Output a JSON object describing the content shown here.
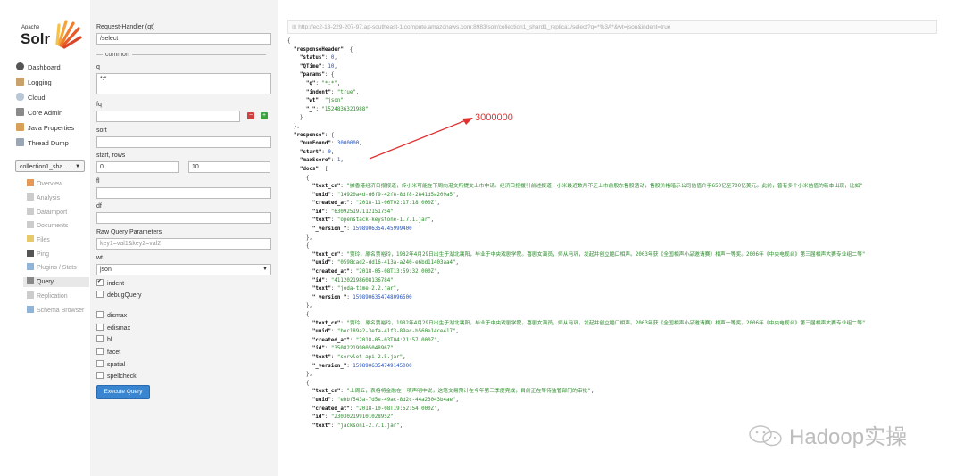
{
  "logo": {
    "apache": "Apache",
    "solr": "Solr"
  },
  "nav": {
    "items": [
      {
        "label": "Dashboard",
        "icon": "dashboard-icon"
      },
      {
        "label": "Logging",
        "icon": "logging-icon"
      },
      {
        "label": "Cloud",
        "icon": "cloud-icon"
      },
      {
        "label": "Core Admin",
        "icon": "core-admin-icon"
      },
      {
        "label": "Java Properties",
        "icon": "java-icon"
      },
      {
        "label": "Thread Dump",
        "icon": "thread-dump-icon"
      }
    ],
    "core_selector": "collection1_sha...",
    "core_items": [
      {
        "label": "Overview"
      },
      {
        "label": "Analysis"
      },
      {
        "label": "Dataimport"
      },
      {
        "label": "Documents"
      },
      {
        "label": "Files"
      },
      {
        "label": "Ping"
      },
      {
        "label": "Plugins / Stats"
      },
      {
        "label": "Query"
      },
      {
        "label": "Replication"
      },
      {
        "label": "Schema Browser"
      }
    ]
  },
  "form": {
    "request_handler_label": "Request-Handler (qt)",
    "request_handler_value": "/select",
    "common_label": "common",
    "q_label": "q",
    "q_value": "*:*",
    "fq_label": "fq",
    "fq_value": "",
    "sort_label": "sort",
    "sort_value": "",
    "start_rows_label": "start, rows",
    "start_value": "0",
    "rows_value": "10",
    "fl_label": "fl",
    "fl_value": "",
    "df_label": "df",
    "df_value": "",
    "raw_label": "Raw Query Parameters",
    "raw_value": "key1=val1&key2=val2",
    "wt_label": "wt",
    "wt_value": "json",
    "indent_label": "indent",
    "debug_label": "debugQuery",
    "dismax_label": "dismax",
    "edismax_label": "edismax",
    "hl_label": "hl",
    "facet_label": "facet",
    "spatial_label": "spatial",
    "spellcheck_label": "spellcheck",
    "execute_label": "Execute Query"
  },
  "result": {
    "url": "http://ec2-13-229-207-97.ap-southeast-1.compute.amazonaws.com:8983/solr/collection1_shard1_replica1/select?q=*%3A*&wt=json&indent=true",
    "annotation": "3000000",
    "watermark": "Hadoop实操",
    "lines": [
      {
        "t": [
          [
            "p",
            "{"
          ]
        ]
      },
      {
        "t": [
          [
            "p",
            "  "
          ],
          [
            "k",
            "\"responseHeader\""
          ],
          [
            "p",
            ": {"
          ]
        ]
      },
      {
        "t": [
          [
            "p",
            "    "
          ],
          [
            "k",
            "\"status\""
          ],
          [
            "p",
            ": "
          ],
          [
            "n",
            "0"
          ],
          [
            "p",
            ","
          ]
        ]
      },
      {
        "t": [
          [
            "p",
            "    "
          ],
          [
            "k",
            "\"QTime\""
          ],
          [
            "p",
            ": "
          ],
          [
            "n",
            "10"
          ],
          [
            "p",
            ","
          ]
        ]
      },
      {
        "t": [
          [
            "p",
            "    "
          ],
          [
            "k",
            "\"params\""
          ],
          [
            "p",
            ": {"
          ]
        ]
      },
      {
        "t": [
          [
            "p",
            "      "
          ],
          [
            "k",
            "\"q\""
          ],
          [
            "p",
            ": "
          ],
          [
            "s",
            "\"*:*\""
          ],
          [
            "p",
            ","
          ]
        ]
      },
      {
        "t": [
          [
            "p",
            "      "
          ],
          [
            "k",
            "\"indent\""
          ],
          [
            "p",
            ": "
          ],
          [
            "s",
            "\"true\""
          ],
          [
            "p",
            ","
          ]
        ]
      },
      {
        "t": [
          [
            "p",
            "      "
          ],
          [
            "k",
            "\"wt\""
          ],
          [
            "p",
            ": "
          ],
          [
            "s",
            "\"json\""
          ],
          [
            "p",
            ","
          ]
        ]
      },
      {
        "t": [
          [
            "p",
            "      "
          ],
          [
            "k",
            "\"_\""
          ],
          [
            "p",
            ": "
          ],
          [
            "s",
            "\"1524836321988\""
          ]
        ]
      },
      {
        "t": [
          [
            "p",
            "    }"
          ]
        ]
      },
      {
        "t": [
          [
            "p",
            "  },"
          ]
        ]
      },
      {
        "t": [
          [
            "p",
            "  "
          ],
          [
            "k",
            "\"response\""
          ],
          [
            "p",
            ": {"
          ]
        ]
      },
      {
        "t": [
          [
            "p",
            "    "
          ],
          [
            "k",
            "\"numFound\""
          ],
          [
            "p",
            ": "
          ],
          [
            "n",
            "3000000"
          ],
          [
            "p",
            ","
          ]
        ]
      },
      {
        "t": [
          [
            "p",
            "    "
          ],
          [
            "k",
            "\"start\""
          ],
          [
            "p",
            ": "
          ],
          [
            "n",
            "0"
          ],
          [
            "p",
            ","
          ]
        ]
      },
      {
        "t": [
          [
            "p",
            "    "
          ],
          [
            "k",
            "\"maxScore\""
          ],
          [
            "p",
            ": "
          ],
          [
            "n",
            "1"
          ],
          [
            "p",
            ","
          ]
        ]
      },
      {
        "t": [
          [
            "p",
            "    "
          ],
          [
            "k",
            "\"docs\""
          ],
          [
            "p",
            ": ["
          ]
        ]
      },
      {
        "t": [
          [
            "p",
            "      {"
          ]
        ]
      },
      {
        "t": [
          [
            "p",
            "        "
          ],
          [
            "k",
            "\"text_cn\""
          ],
          [
            "p",
            ": "
          ],
          [
            "s",
            "\"據香港经济日报报道，传小米可能在下周向港交所提交上市申请。经济日报援引前述报道，小米最近数月不乏上市前股东售股活动，售股价格暗示公司估值介乎650亿至700亿美元。此前，曾有多个小米估值的新本出现，比如\""
          ]
        ]
      },
      {
        "t": [
          [
            "p",
            "        "
          ],
          [
            "k",
            "\"uuid\""
          ],
          [
            "p",
            ": "
          ],
          [
            "s",
            "\"14920a4d-d6f9-42f8-8df8-2841d5a209a5\""
          ],
          [
            "p",
            ","
          ]
        ]
      },
      {
        "t": [
          [
            "p",
            "        "
          ],
          [
            "k",
            "\"created_at\""
          ],
          [
            "p",
            ": "
          ],
          [
            "s",
            "\"2018-11-06T02:17:18.000Z\""
          ],
          [
            "p",
            ","
          ]
        ]
      },
      {
        "t": [
          [
            "p",
            "        "
          ],
          [
            "k",
            "\"id\""
          ],
          [
            "p",
            ": "
          ],
          [
            "s",
            "\"630925197112151754\""
          ],
          [
            "p",
            ","
          ]
        ]
      },
      {
        "t": [
          [
            "p",
            "        "
          ],
          [
            "k",
            "\"text\""
          ],
          [
            "p",
            ": "
          ],
          [
            "s",
            "\"openstack-keystone-1.7.1.jar\""
          ],
          [
            "p",
            ","
          ]
        ]
      },
      {
        "t": [
          [
            "p",
            "        "
          ],
          [
            "k",
            "\"_version_\""
          ],
          [
            "p",
            ": "
          ],
          [
            "n",
            "1598906354745999400"
          ]
        ]
      },
      {
        "t": [
          [
            "p",
            "      },"
          ]
        ]
      },
      {
        "t": [
          [
            "p",
            "      {"
          ]
        ]
      },
      {
        "t": [
          [
            "p",
            "        "
          ],
          [
            "k",
            "\"text_cn\""
          ],
          [
            "p",
            ": "
          ],
          [
            "s",
            "\"贾玲，原名贾裕玲，1982年4月29日出生于湖北襄阳，毕业于中央戏剧学院。喜剧女演员，师从冯巩，发起并创立酷口相声。2003年获《全国相声小品邀请赛》相声一等奖。2006年《中央电视台》第三届相声大赛专业组二等\""
          ]
        ]
      },
      {
        "t": [
          [
            "p",
            "        "
          ],
          [
            "k",
            "\"uuid\""
          ],
          [
            "p",
            ": "
          ],
          [
            "s",
            "\"0598cad2-dd16-413a-a240-e6bd11403aa4\""
          ],
          [
            "p",
            ","
          ]
        ]
      },
      {
        "t": [
          [
            "p",
            "        "
          ],
          [
            "k",
            "\"created_at\""
          ],
          [
            "p",
            ": "
          ],
          [
            "s",
            "\"2018-05-08T13:59:32.000Z\""
          ],
          [
            "p",
            ","
          ]
        ]
      },
      {
        "t": [
          [
            "p",
            "        "
          ],
          [
            "k",
            "\"id\""
          ],
          [
            "p",
            ": "
          ],
          [
            "s",
            "\"411202198608136784\""
          ],
          [
            "p",
            ","
          ]
        ]
      },
      {
        "t": [
          [
            "p",
            "        "
          ],
          [
            "k",
            "\"text\""
          ],
          [
            "p",
            ": "
          ],
          [
            "s",
            "\"joda-time-2.2.jar\""
          ],
          [
            "p",
            ","
          ]
        ]
      },
      {
        "t": [
          [
            "p",
            "        "
          ],
          [
            "k",
            "\"_version_\""
          ],
          [
            "p",
            ": "
          ],
          [
            "n",
            "1598906354748096500"
          ]
        ]
      },
      {
        "t": [
          [
            "p",
            "      },"
          ]
        ]
      },
      {
        "t": [
          [
            "p",
            "      {"
          ]
        ]
      },
      {
        "t": [
          [
            "p",
            "        "
          ],
          [
            "k",
            "\"text_cn\""
          ],
          [
            "p",
            ": "
          ],
          [
            "s",
            "\"贾玲，原名贾裕玲，1982年4月29日出生于湖北襄阳，毕业于中央戏剧学院。喜剧女演员，师从冯巩，发起并创立酷口相声。2003年获《全国相声小品邀请赛》相声一等奖。2006年《中央电视台》第三届相声大赛专业组二等\""
          ]
        ]
      },
      {
        "t": [
          [
            "p",
            "        "
          ],
          [
            "k",
            "\"uuid\""
          ],
          [
            "p",
            ": "
          ],
          [
            "s",
            "\"bec189a2-3efa-41f3-89ac-b560e14ce417\""
          ],
          [
            "p",
            ","
          ]
        ]
      },
      {
        "t": [
          [
            "p",
            "        "
          ],
          [
            "k",
            "\"created_at\""
          ],
          [
            "p",
            ": "
          ],
          [
            "s",
            "\"2018-05-03T04:21:57.000Z\""
          ],
          [
            "p",
            ","
          ]
        ]
      },
      {
        "t": [
          [
            "p",
            "        "
          ],
          [
            "k",
            "\"id\""
          ],
          [
            "p",
            ": "
          ],
          [
            "s",
            "\"350822199005048967\""
          ],
          [
            "p",
            ","
          ]
        ]
      },
      {
        "t": [
          [
            "p",
            "        "
          ],
          [
            "k",
            "\"text\""
          ],
          [
            "p",
            ": "
          ],
          [
            "s",
            "\"servlet-api-2.5.jar\""
          ],
          [
            "p",
            ","
          ]
        ]
      },
      {
        "t": [
          [
            "p",
            "        "
          ],
          [
            "k",
            "\"_version_\""
          ],
          [
            "p",
            ": "
          ],
          [
            "n",
            "1598906354749145000"
          ]
        ]
      },
      {
        "t": [
          [
            "p",
            "      },"
          ]
        ]
      },
      {
        "t": [
          [
            "p",
            "      {"
          ]
        ]
      },
      {
        "t": [
          [
            "p",
            "        "
          ],
          [
            "k",
            "\"text_cn\""
          ],
          [
            "p",
            ": "
          ],
          [
            "s",
            "\"上周五，表格将金融在一项声明中说，这笔交易预计在今年第三季度完成，目前正在等待监管部门的审批\""
          ],
          [
            "p",
            ","
          ]
        ]
      },
      {
        "t": [
          [
            "p",
            "        "
          ],
          [
            "k",
            "\"uuid\""
          ],
          [
            "p",
            ": "
          ],
          [
            "s",
            "\"ebbf543a-7d5e-49ac-8d2c-44a23043b4ae\""
          ],
          [
            "p",
            ","
          ]
        ]
      },
      {
        "t": [
          [
            "p",
            "        "
          ],
          [
            "k",
            "\"created_at\""
          ],
          [
            "p",
            ": "
          ],
          [
            "s",
            "\"2018-10-08T19:52:54.000Z\""
          ],
          [
            "p",
            ","
          ]
        ]
      },
      {
        "t": [
          [
            "p",
            "        "
          ],
          [
            "k",
            "\"id\""
          ],
          [
            "p",
            ": "
          ],
          [
            "s",
            "\"230302199101028952\""
          ],
          [
            "p",
            ","
          ]
        ]
      },
      {
        "t": [
          [
            "p",
            "        "
          ],
          [
            "k",
            "\"text\""
          ],
          [
            "p",
            ": "
          ],
          [
            "s",
            "\"jackson1-2.7.1.jar\""
          ],
          [
            "p",
            ","
          ]
        ]
      }
    ]
  },
  "colors": {
    "accent": "#3a85d0",
    "json_key": "#111111",
    "json_string": "#2a8a2a",
    "json_number": "#2050c0",
    "annotation": "#e03030"
  }
}
